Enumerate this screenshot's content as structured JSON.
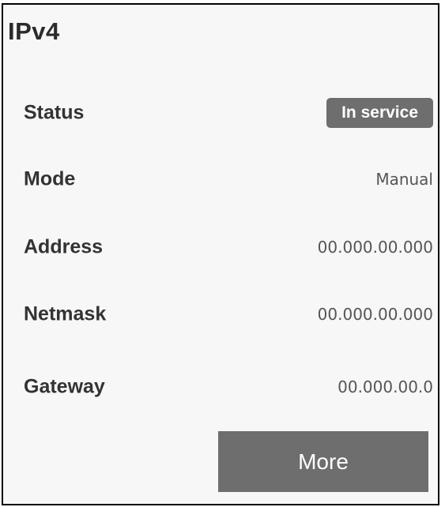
{
  "panel": {
    "title": "IPv4"
  },
  "fields": {
    "status": {
      "label": "Status",
      "value": "In service"
    },
    "mode": {
      "label": "Mode",
      "value": "Manual"
    },
    "address": {
      "label": "Address",
      "value": "00.000.00.000"
    },
    "netmask": {
      "label": "Netmask",
      "value": "00.000.00.000"
    },
    "gateway": {
      "label": "Gateway",
      "value": "00.000.00.0"
    }
  },
  "actions": {
    "more_label": "More"
  },
  "colors": {
    "panel_background": "#f7f7f7",
    "border": "#000000",
    "badge_background": "#6e6e6e",
    "button_background": "#6e6e6e",
    "label_text": "#333333",
    "value_text": "#555555"
  }
}
